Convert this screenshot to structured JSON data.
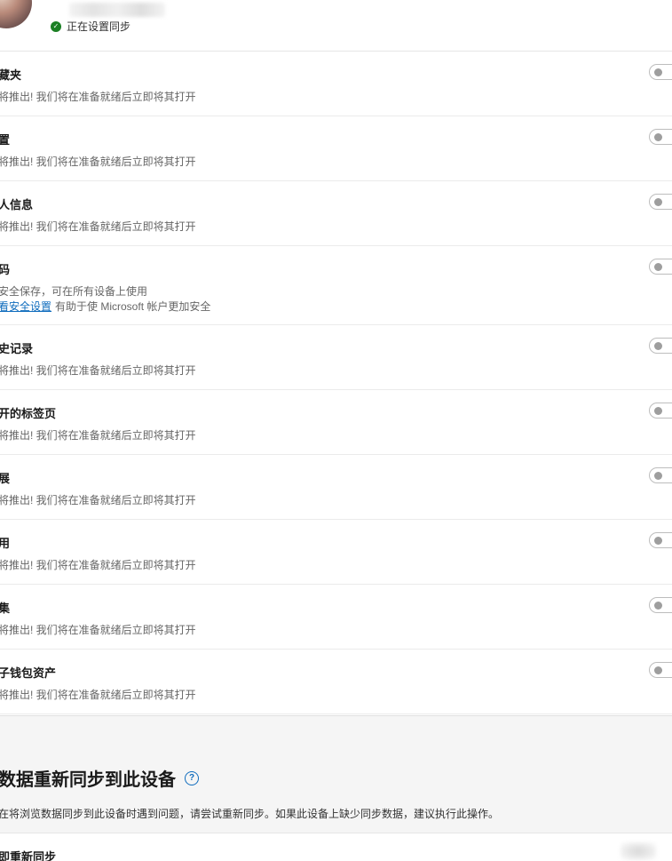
{
  "profile": {
    "status": "正在设置同步"
  },
  "items": [
    {
      "title": "藏夹",
      "desc": "将推出! 我们将在准备就绪后立即将其打开"
    },
    {
      "title": "置",
      "desc": "将推出! 我们将在准备就绪后立即将其打开"
    },
    {
      "title": "人信息",
      "desc": "将推出! 我们将在准备就绪后立即将其打开"
    },
    {
      "title": "码",
      "desc": "安全保存，可在所有设备上使用",
      "link": "看安全设置",
      "link_suffix": "有助于使 Microsoft 帐户更加安全"
    },
    {
      "title": "史记录",
      "desc": "将推出! 我们将在准备就绪后立即将其打开"
    },
    {
      "title": "开的标签页",
      "desc": "将推出! 我们将在准备就绪后立即将其打开"
    },
    {
      "title": "展",
      "desc": "将推出! 我们将在准备就绪后立即将其打开"
    },
    {
      "title": "用",
      "desc": "将推出! 我们将在准备就绪后立即将其打开"
    },
    {
      "title": "集",
      "desc": "将推出! 我们将在准备就绪后立即将其打开"
    },
    {
      "title": "子钱包资产",
      "desc": "将推出! 我们将在准备就绪后立即将其打开"
    }
  ],
  "resync": {
    "title": "数据重新同步到此设备",
    "desc": "在将浏览数据同步到此设备时遇到问题，请尝试重新同步。如果此设备上缺少同步数据，建议执行此操作。",
    "action_label": "即重新同步"
  },
  "colors": {
    "sync_ok": "#1b7f24",
    "link": "#0f6cbd",
    "section_bg": "#f5f5f5"
  },
  "icons": {
    "status": "sync-check-icon",
    "help": "help-circle-icon"
  }
}
